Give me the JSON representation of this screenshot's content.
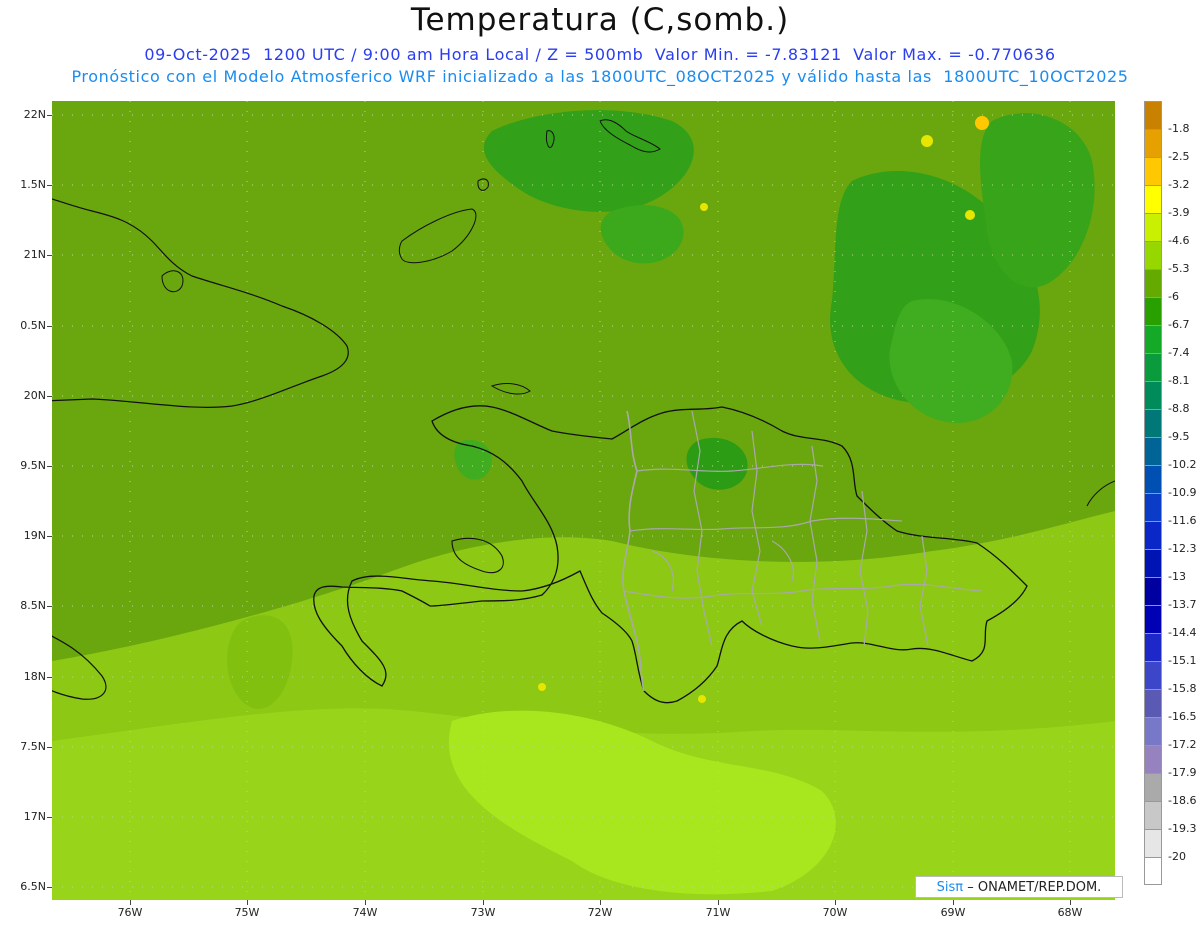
{
  "title": "Temperatura (C,somb.)",
  "subtitle_line1": "09-Oct-2025  1200 UTC / 9:00 am Hora Local / Z = 500mb  Valor Min. = -7.83121  Valor Max. = -0.770636",
  "subtitle_line2": "Pronóstico con el Modelo Atmosferico WRF inicializado a las 1800UTC_08OCT2025 y válido hasta las  1800UTC_10OCT2025",
  "lat_labels": [
    "22N",
    "1.5N",
    "21N",
    "0.5N",
    "20N",
    "9.5N",
    "19N",
    "8.5N",
    "18N",
    "7.5N",
    "17N",
    "6.5N"
  ],
  "lon_labels": [
    "76W",
    "75W",
    "74W",
    "73W",
    "72W",
    "71W",
    "70W",
    "69W",
    "68W"
  ],
  "colorbar": {
    "labels": [
      "-1.8",
      "-2.5",
      "-3.2",
      "-3.9",
      "-4.6",
      "-5.3",
      "-6",
      "-6.7",
      "-7.4",
      "-8.1",
      "-8.8",
      "-9.5",
      "-10.2",
      "-10.9",
      "-11.6",
      "-12.3",
      "-13",
      "-13.7",
      "-14.4",
      "-15.1",
      "-15.8",
      "-16.5",
      "-17.2",
      "-17.9",
      "-18.6",
      "-19.3",
      "-20"
    ],
    "colors": [
      "#c88200",
      "#e6a000",
      "#ffc800",
      "#ffff00",
      "#c8f000",
      "#96d700",
      "#64aa00",
      "#28a000",
      "#14aa28",
      "#0a9b3c",
      "#008c5a",
      "#007878",
      "#006496",
      "#0050b4",
      "#0a3cc8",
      "#0a28c8",
      "#0014b4",
      "#0000a0",
      "#0000b4",
      "#1e28c8",
      "#3c46c8",
      "#5a5ab4",
      "#7878c8",
      "#9682be",
      "#aaaaaa",
      "#c8c8c8",
      "#e6e6e6",
      "#ffffff"
    ]
  },
  "credit": {
    "logo": "Sisπ",
    "text": "– ONAMET/REP.DOM."
  },
  "map_data": {
    "variable": "Temperatura 500mb",
    "units": "C",
    "min": -7.83121,
    "max": -0.770636,
    "lon_range": [
      -76.6,
      -67.6
    ],
    "lat_range": [
      16.4,
      22.1
    ]
  }
}
